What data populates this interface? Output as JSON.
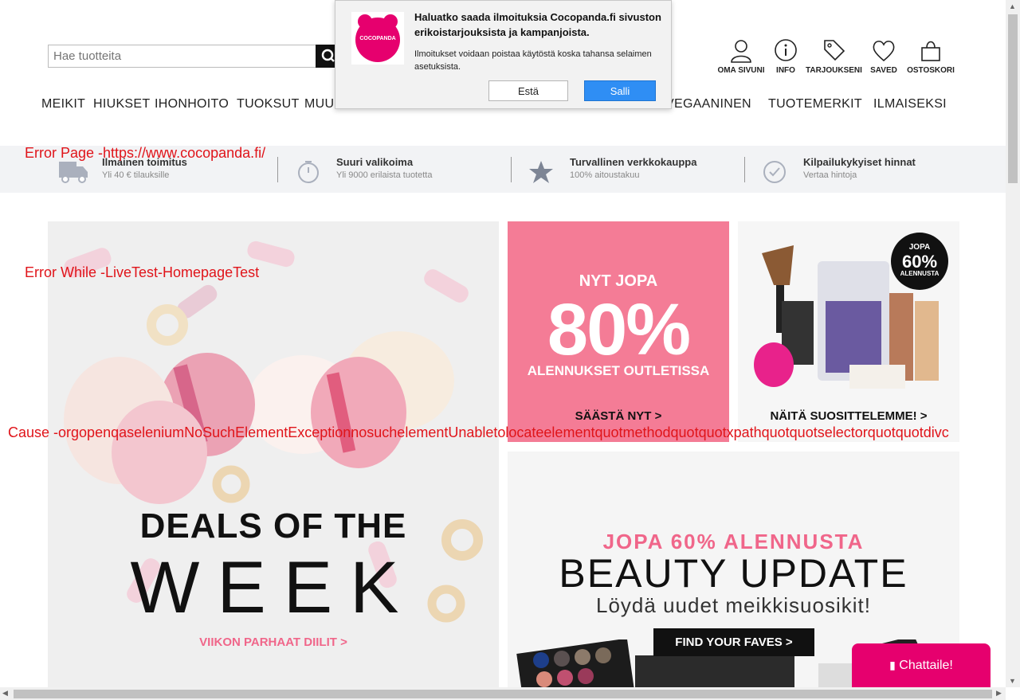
{
  "search": {
    "placeholder": "Hae tuotteita"
  },
  "header_icons": [
    {
      "label": "OMA SIVUNI",
      "icon": "user-icon"
    },
    {
      "label": "INFO",
      "icon": "info-icon"
    },
    {
      "label": "TARJOUKSENI",
      "icon": "tag-icon"
    },
    {
      "label": "SAVED",
      "icon": "heart-icon"
    },
    {
      "label": "OSTOSKORI",
      "icon": "basket-icon"
    }
  ],
  "nav": [
    "MEIKIT",
    "HIUKSET",
    "IHONHOITO",
    "TUOKSUT",
    "MUU",
    "VEGAANINEN",
    "TUOTEMERKIT",
    "ILMAISEKSI"
  ],
  "usp": [
    {
      "title": "Ilmainen toimitus",
      "sub": "Yli 40 € tilauksille",
      "icon": "truck-icon"
    },
    {
      "title": "Suuri valikoima",
      "sub": "Yli 9000 erilaista tuotetta",
      "icon": "stopwatch-icon"
    },
    {
      "title": "Turvallinen verkkokauppa",
      "sub": "100% aitoustakuu",
      "icon": "star-icon"
    },
    {
      "title": "Kilpailukykyiset hinnat",
      "sub": "Vertaa hintoja",
      "icon": "check-circle-icon"
    }
  ],
  "banners": {
    "deals": {
      "line1": "DEALS OF THE",
      "line2": "WEEK",
      "cta": "VIIKON PARHAAT DIILIT >"
    },
    "outlet": {
      "pre": "NYT JOPA",
      "big": "80%",
      "sub": "ALENNUKSET OUTLETISSA",
      "cta": "SÄÄSTÄ NYT >"
    },
    "suggest": {
      "badge_top": "JOPA",
      "badge_pct": "60%",
      "badge_bottom": "ALENNUSTA",
      "cta": "NÄITÄ SUOSITTELEMME! >"
    },
    "beauty": {
      "pre": "JOPA 60% ALENNUSTA",
      "title": "BEAUTY UPDATE",
      "sub": "Löydä uudet meikkisuosikit!",
      "cta": "FIND YOUR FAVES >"
    }
  },
  "notification": {
    "logo_text": "COCOPANDA",
    "title": "Haluatko saada ilmoituksia Cocopanda.fi sivuston erikoistarjouksista ja kampanjoista.",
    "body": "Ilmoitukset voidaan poistaa käytöstä koska tahansa selaimen asetuksista.",
    "block": "Estä",
    "allow": "Salli"
  },
  "errors": {
    "page": "Error Page -https://www.cocopanda.fi/",
    "while": "Error While -LiveTest-HomepageTest",
    "cause": "Cause -orgopenqaseleniumNoSuchElementExceptionnosuchelementUnabletolocateelementquotmethodquotquotxpathquotquotselectorquotquotdivc"
  },
  "chat": {
    "label": "Chattaile!"
  },
  "colors": {
    "brand": "#e6006e",
    "outlet_bg": "#f47c96",
    "error": "#e0141a",
    "allow": "#2f8ef4"
  }
}
